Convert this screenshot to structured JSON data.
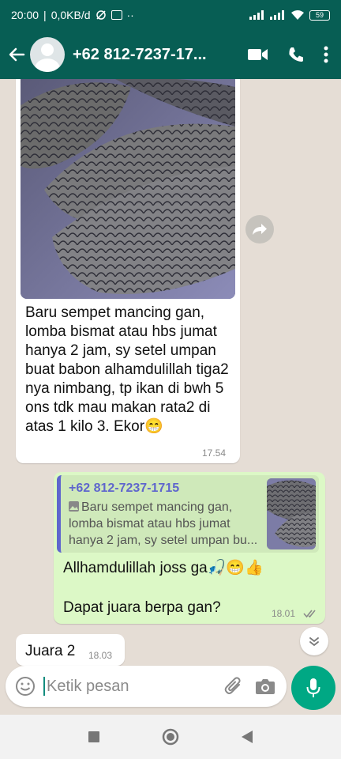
{
  "status_bar": {
    "time": "20:00",
    "network_speed": "0,0KB/d",
    "battery": "59"
  },
  "header": {
    "contact": "+62 812-7237-17..."
  },
  "messages": {
    "incoming_photo": {
      "text": "Baru sempet mancing gan, lomba bismat atau hbs jumat hanya 2 jam, sy setel umpan buat babon alhamdulillah tiga2 nya nimbang, tp ikan di bwh 5 ons tdk mau makan rata2 di atas 1 kilo 3. Ekor😁",
      "time": "17.54"
    },
    "outgoing_reply": {
      "quote_name": "+62 812-7237-1715",
      "quote_text": "Baru sempet mancing gan, lomba bismat atau hbs jumat hanya 2 jam, sy setel umpan bu...",
      "text_line1": "Allhamdulillah joss ga🎣😁👍",
      "text_line2": "Dapat juara berpa gan?",
      "time": "18.01"
    },
    "incoming_short": {
      "text": "Juara 2",
      "time": "18.03"
    }
  },
  "composer": {
    "placeholder": "Ketik pesan"
  },
  "icons": [
    "back-arrow-icon",
    "avatar-icon",
    "video-call-icon",
    "phone-icon",
    "more-icon",
    "forward-icon",
    "scroll-down-icon",
    "emoji-icon",
    "attach-icon",
    "camera-icon",
    "mic-icon",
    "nav-recent-icon",
    "nav-home-icon",
    "nav-back-icon"
  ],
  "colors": {
    "header": "#075e54",
    "chat_bg": "#e5ddd5",
    "outgoing": "#dcf8c6",
    "accent": "#00a884",
    "quote_name": "#5f66cd"
  }
}
